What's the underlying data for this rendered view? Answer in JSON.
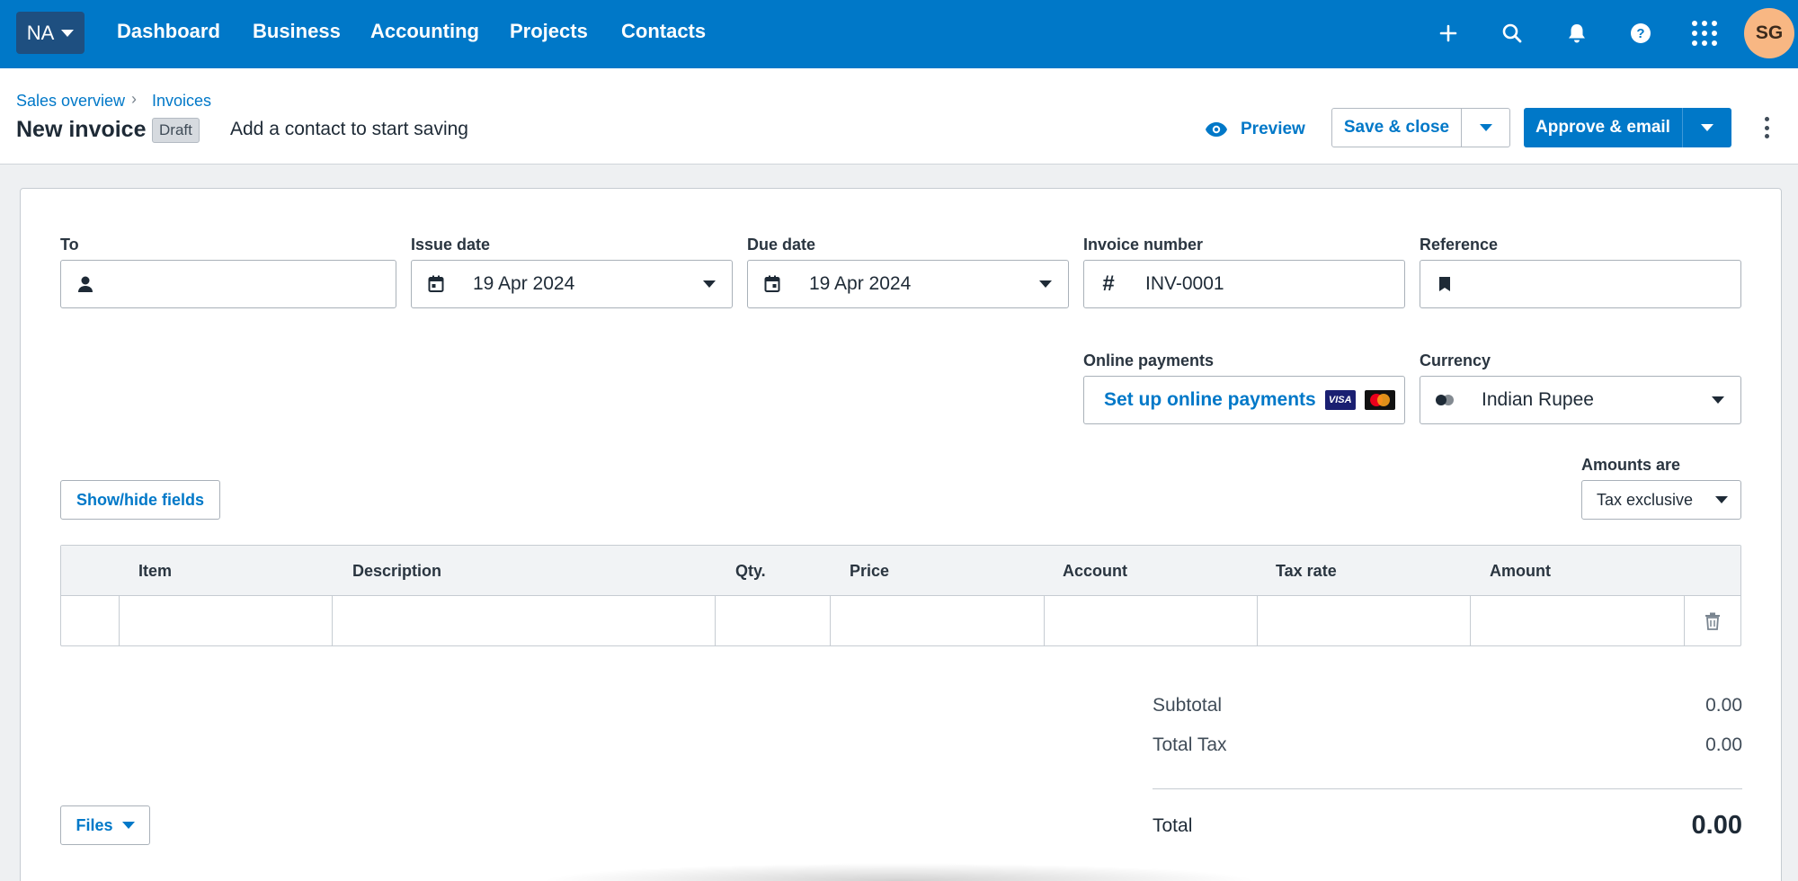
{
  "nav": {
    "org": "NA",
    "links": [
      "Dashboard",
      "Business",
      "Accounting",
      "Projects",
      "Contacts"
    ],
    "icons": [
      "plus-icon",
      "search-icon",
      "bell-icon",
      "help-icon",
      "apps-grid-icon"
    ],
    "avatar": "SG"
  },
  "breadcrumb": {
    "items": [
      "Sales overview",
      "Invoices"
    ]
  },
  "header": {
    "title": "New invoice",
    "status": "Draft",
    "hint": "Add a contact to start saving",
    "preview_label": "Preview",
    "save_label": "Save & close",
    "approve_label": "Approve & email"
  },
  "form": {
    "to": {
      "label": "To",
      "value": ""
    },
    "issue_date": {
      "label": "Issue date",
      "value": "19 Apr 2024"
    },
    "due_date": {
      "label": "Due date",
      "value": "19 Apr 2024"
    },
    "invoice_number": {
      "label": "Invoice number",
      "value": "INV-0001"
    },
    "reference": {
      "label": "Reference",
      "value": ""
    },
    "online_payments": {
      "label": "Online payments",
      "link": "Set up online payments",
      "card_visa": "VISA"
    },
    "currency": {
      "label": "Currency",
      "value": "Indian Rupee"
    },
    "amounts_are": {
      "label": "Amounts are",
      "value": "Tax exclusive"
    },
    "show_hide": "Show/hide fields",
    "files": "Files"
  },
  "table": {
    "columns": [
      "Item",
      "Description",
      "Qty.",
      "Price",
      "Account",
      "Tax rate",
      "Amount"
    ]
  },
  "totals": {
    "subtotal_label": "Subtotal",
    "subtotal": "0.00",
    "tax_label": "Total Tax",
    "tax": "0.00",
    "total_label": "Total",
    "total": "0.00"
  },
  "colors": {
    "brand": "#0078c8",
    "org_bg": "#1e4f80",
    "avatar_bg": "#f8b783"
  }
}
